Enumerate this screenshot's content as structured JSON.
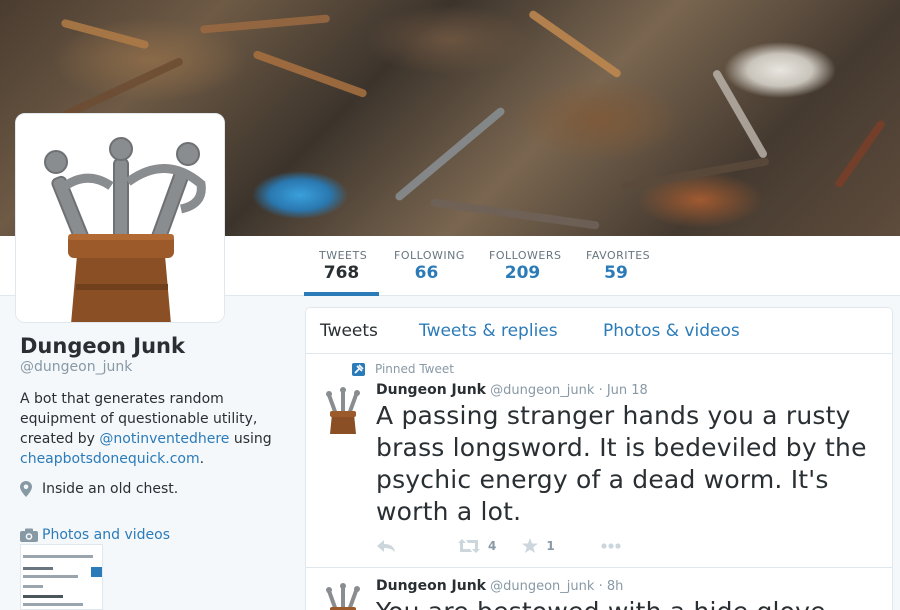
{
  "profile": {
    "name": "Dungeon Junk",
    "handle": "@dungeon_junk",
    "bio_prefix": "A bot that generates random equipment of questionable utility, created by ",
    "bio_mention": "@notinventedhere",
    "bio_middle": " using ",
    "bio_link": "cheapbotsdonequick.com",
    "bio_suffix": ".",
    "location": "Inside an old chest.",
    "photos_label": "Photos and videos"
  },
  "stats": [
    {
      "label": "TWEETS",
      "value": "768"
    },
    {
      "label": "FOLLOWING",
      "value": "66"
    },
    {
      "label": "FOLLOWERS",
      "value": "209"
    },
    {
      "label": "FAVORITES",
      "value": "59"
    }
  ],
  "tabs": [
    "Tweets",
    "Tweets & replies",
    "Photos & videos"
  ],
  "tweets": [
    {
      "pinned_label": "Pinned Tweet",
      "name": "Dungeon Junk",
      "handle": "@dungeon_junk",
      "time": "Jun 18",
      "text": "A passing stranger hands you a rusty brass longsword. It is bedeviled by the psychic energy of a dead worm. It's worth a lot.",
      "retweets": "4",
      "favorites": "1"
    },
    {
      "name": "Dungeon Junk",
      "handle": "@dungeon_junk",
      "time": "8h",
      "text": "You are bestowed with a hide glove"
    }
  ],
  "colors": {
    "accent": "#2b7bb9",
    "muted": "#8899a6",
    "text": "#292f33"
  },
  "icons": [
    "reply-icon",
    "retweet-icon",
    "star-icon",
    "more-icon",
    "location-pin-icon",
    "camera-icon",
    "pin-icon"
  ]
}
